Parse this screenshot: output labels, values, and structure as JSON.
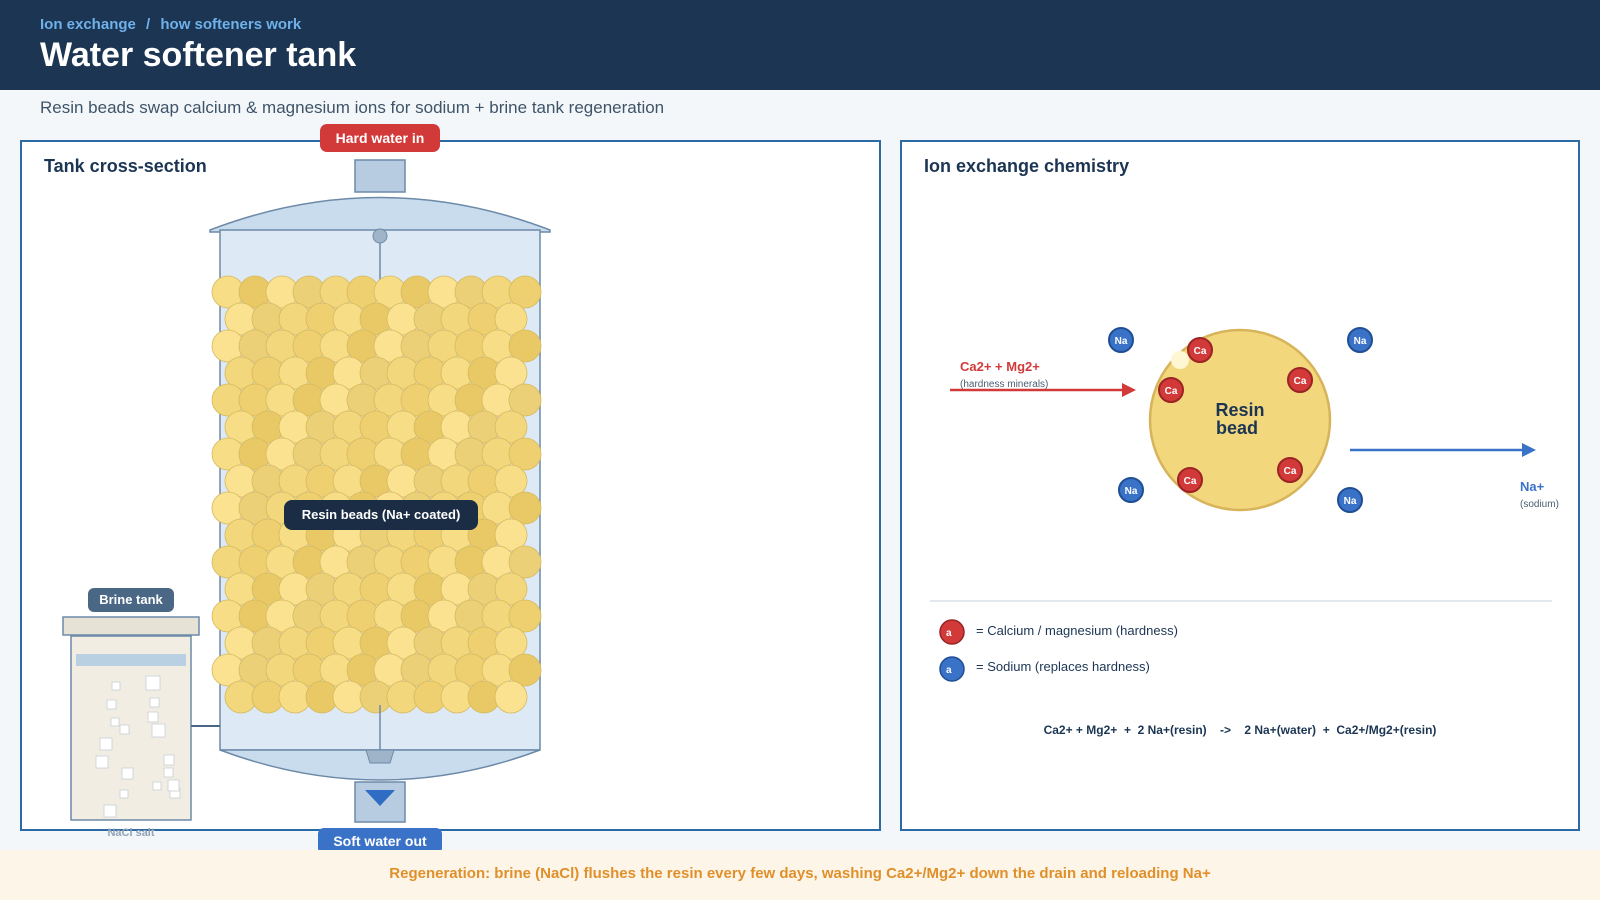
{
  "header": {
    "breadcrumb_root": "Ion exchange",
    "breadcrumb_sep": "/",
    "breadcrumb_current": "how softeners work",
    "title": "Water softener tank"
  },
  "subtitle": "Resin beads swap calcium & magnesium ions for sodium  +  brine tank regeneration",
  "left_panel": {
    "title": "Tank cross-section",
    "inlet_label": "Hard water in",
    "outlet_label": "Soft water out",
    "resin_label": "Resin beads (Na+ coated)",
    "brine_label": "Brine tank",
    "salt_label": "NaCl salt"
  },
  "right_panel": {
    "title": "Ion exchange chemistry",
    "bead_label_line1": "Resin",
    "bead_label_line2": "bead",
    "ca_symbol": "Ca",
    "na_symbol": "Na",
    "incoming_label": "Ca2+ + Mg2+",
    "incoming_sub": "(hardness minerals)",
    "outgoing_label": "Na+",
    "outgoing_sub": "(sodium)",
    "legend": [
      {
        "symbol": "a",
        "text": "= Calcium / magnesium (hardness)"
      },
      {
        "symbol": "a",
        "text": "= Sodium (replaces hardness)"
      }
    ],
    "equation": "Ca2+ + Mg2+  +  2 Na+(resin)    ->    2 Na+(water)  +  Ca2+/Mg2+(resin)"
  },
  "footer": "Regeneration:  brine (NaCl) flushes the resin every few days, washing Ca2+/Mg2+ down the drain and reloading Na+",
  "colors": {
    "header_bg": "#1b3553",
    "accent_red": "#d23a3a",
    "accent_blue": "#3a72c8",
    "resin_gold": "#f0d77a",
    "panel_border": "#2c6aa5",
    "footer_text": "#e0902a"
  },
  "icons": {
    "flow_direction": "down-triangle-icon"
  }
}
